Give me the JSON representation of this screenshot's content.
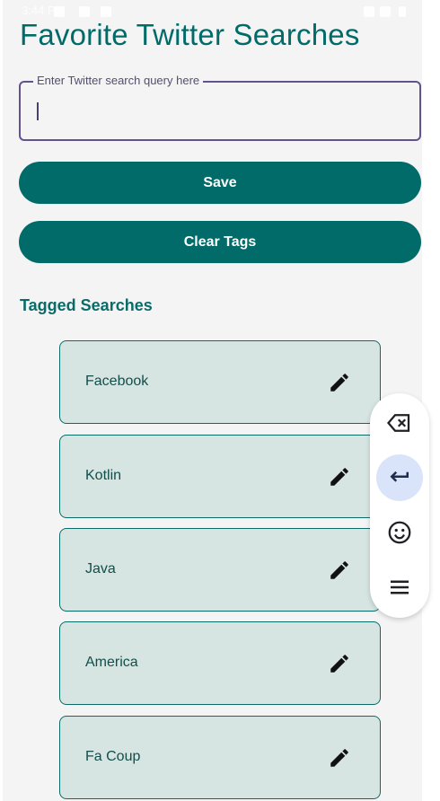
{
  "status_bar": {
    "time": "3:44 PM"
  },
  "app": {
    "title": "Favorite Twitter Searches"
  },
  "query": {
    "label": "Enter Twitter search query here",
    "value": ""
  },
  "buttons": {
    "save": "Save",
    "clear": "Clear Tags"
  },
  "tagged": {
    "heading": "Tagged Searches",
    "items": [
      {
        "label": "Facebook",
        "edit_icon": "pencil-icon"
      },
      {
        "label": "Kotlin",
        "edit_icon": "pencil-icon"
      },
      {
        "label": "Java",
        "edit_icon": "pencil-icon"
      },
      {
        "label": "America",
        "edit_icon": "pencil-icon"
      },
      {
        "label": "Fa Coup",
        "edit_icon": "pencil-icon"
      }
    ]
  },
  "keyboard_toolbar": {
    "items": [
      {
        "icon": "backspace-icon"
      },
      {
        "icon": "enter-icon",
        "active": true
      },
      {
        "icon": "emoji-icon"
      },
      {
        "icon": "menu-icon"
      }
    ]
  },
  "colors": {
    "primary": "#006b68",
    "card_bg": "#d6e5e2",
    "field_border": "#62528e",
    "active_key": "#d9e3fa"
  }
}
